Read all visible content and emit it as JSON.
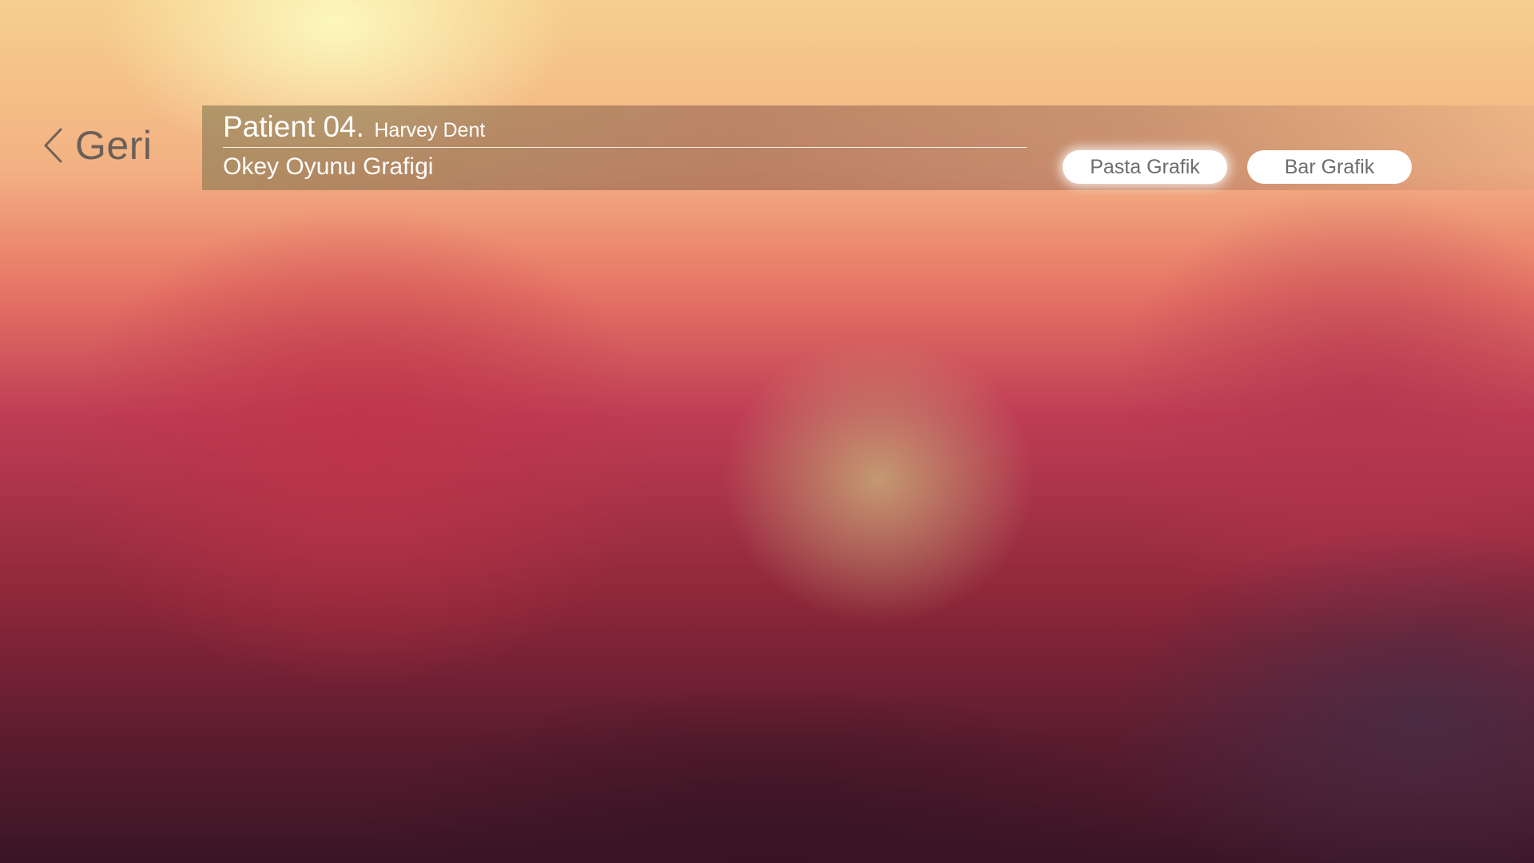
{
  "navigation": {
    "back_label": "Geri"
  },
  "header": {
    "patient_id": "Patient 04.",
    "patient_name": "Harvey Dent",
    "subtitle": "Okey Oyunu Grafigi"
  },
  "chart_toggle": {
    "pie_label": "Pasta Grafik",
    "bar_label": "Bar Grafik",
    "selected": "Pasta Grafik"
  },
  "icons": {
    "back": "chevron-left-icon"
  },
  "colors": {
    "button_background": "#ffffff",
    "button_text": "#6d6d6d",
    "header_text": "#ffffff",
    "back_text": "#6b6058"
  }
}
